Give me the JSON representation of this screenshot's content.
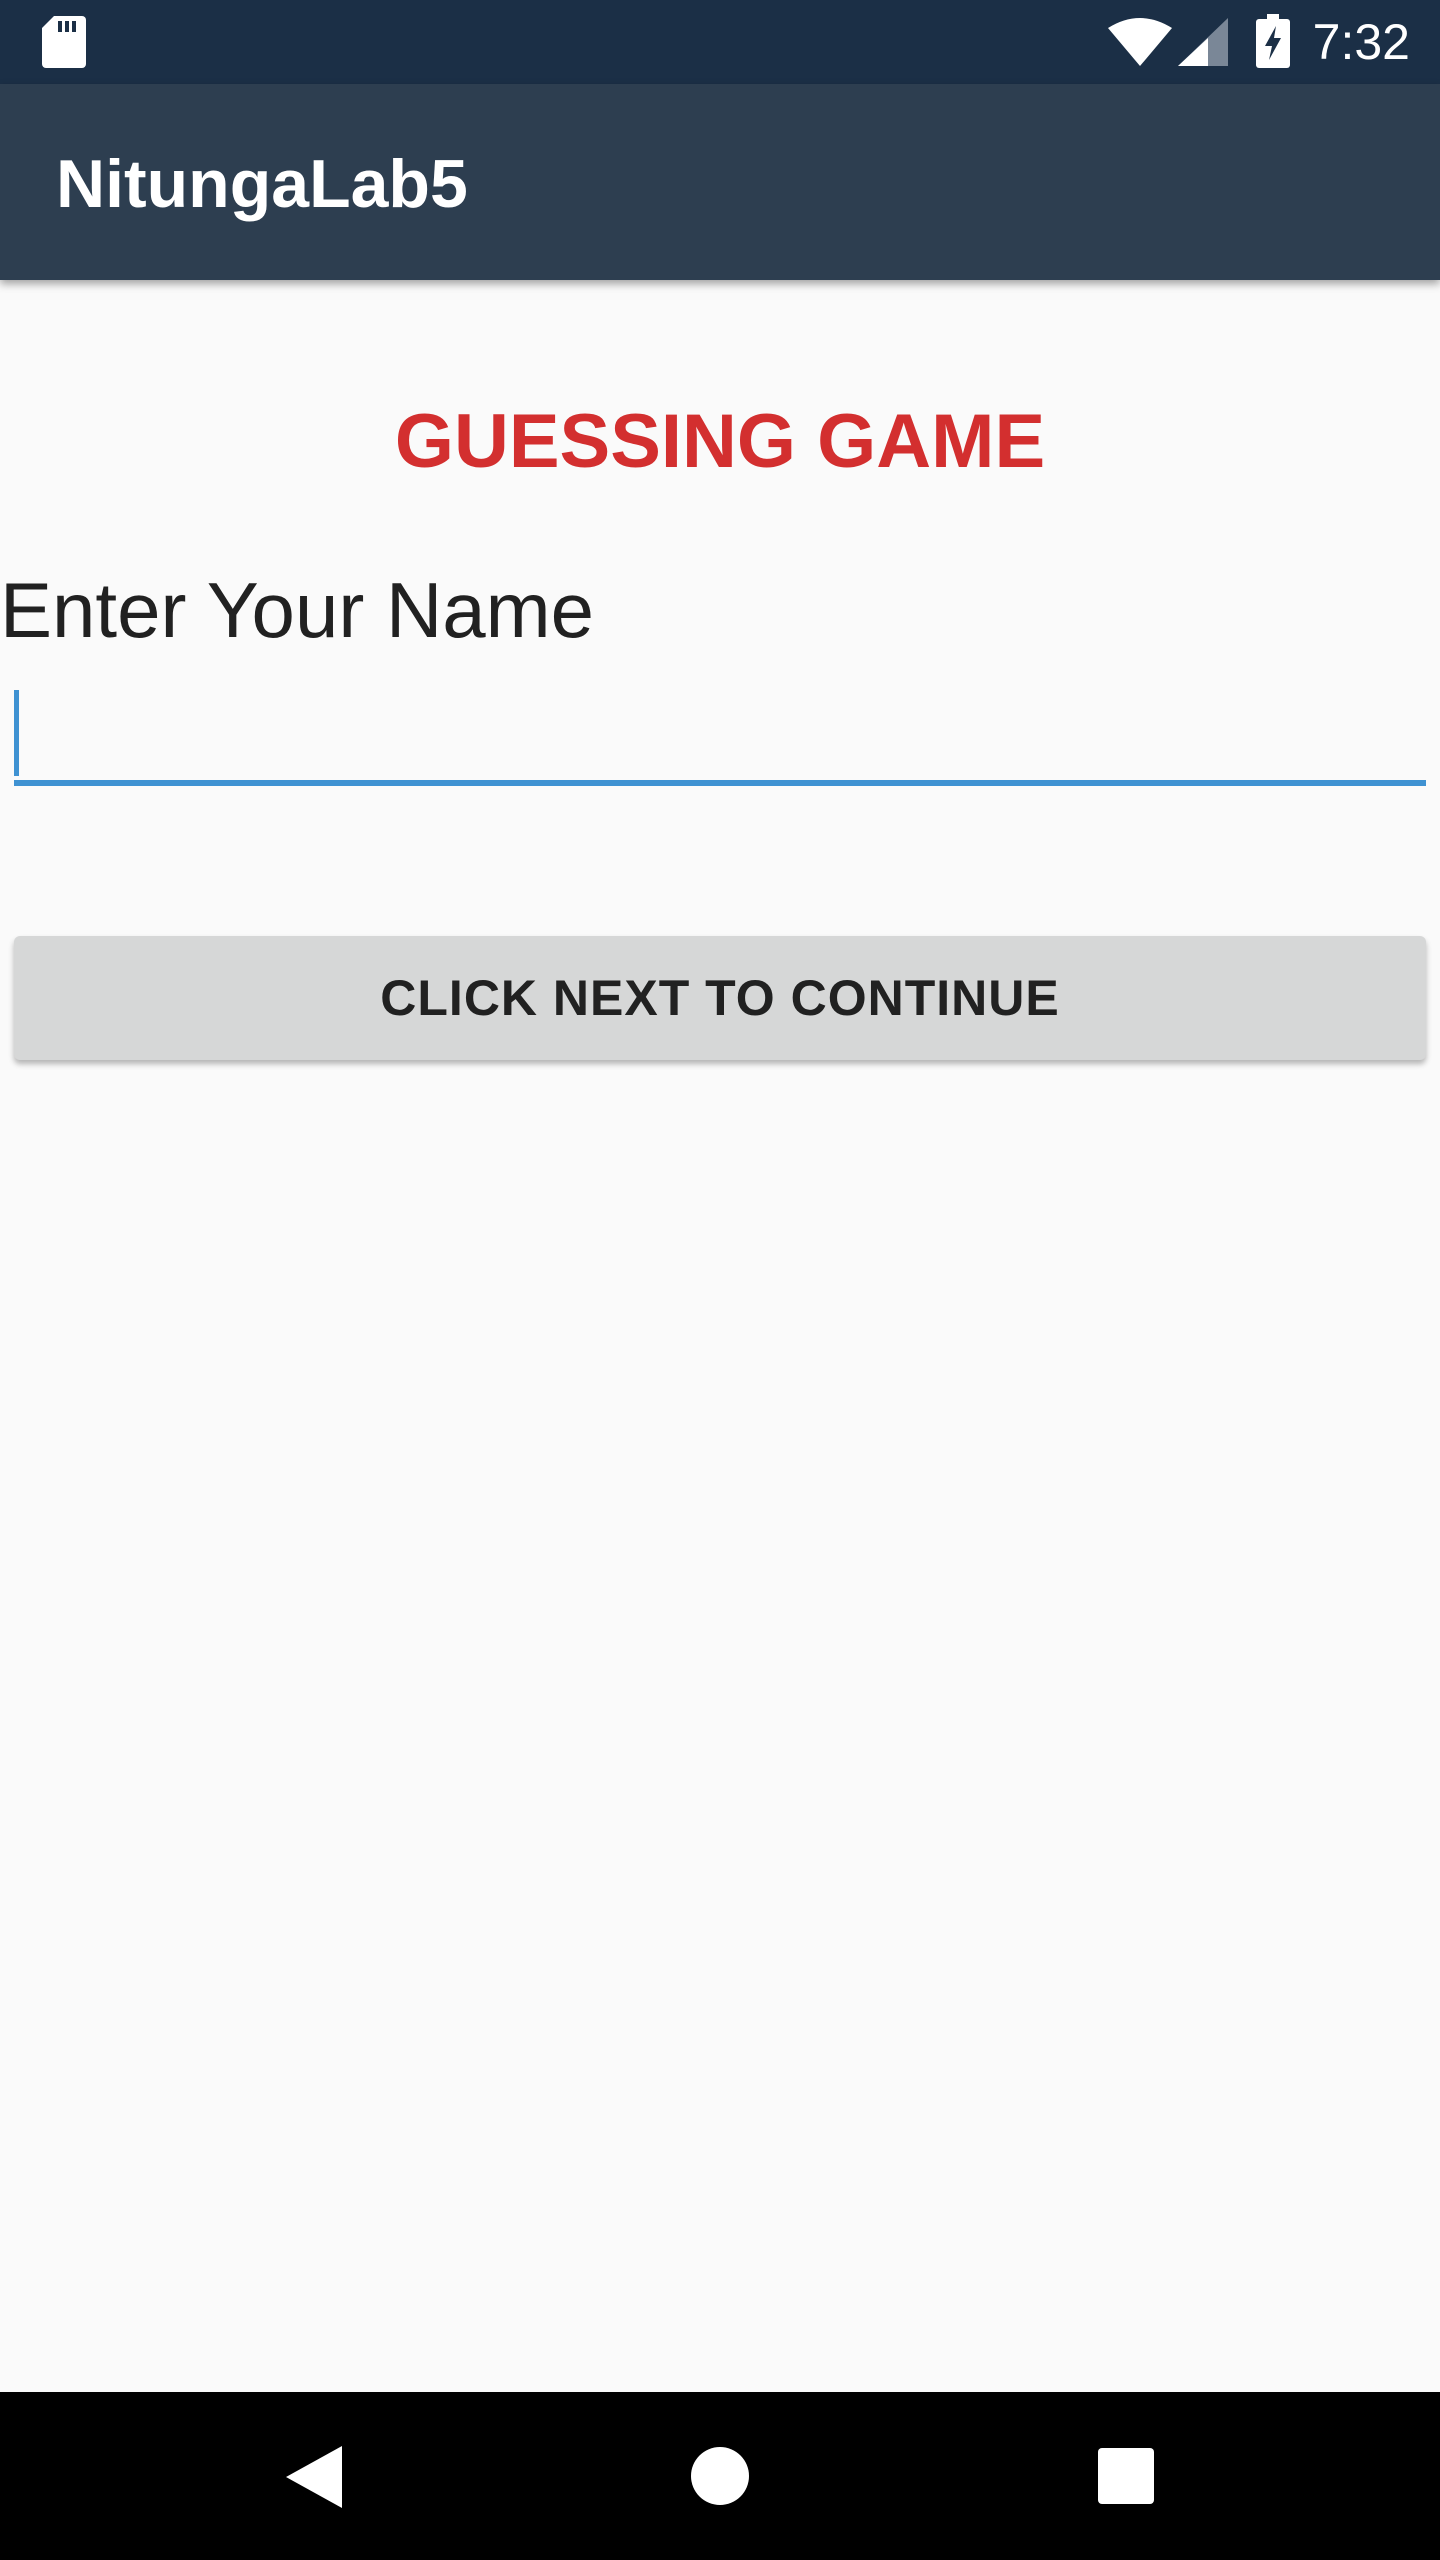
{
  "status_bar": {
    "time": "7:32",
    "icons": [
      "sd-card-icon",
      "wifi-icon",
      "cell-signal-icon",
      "battery-charging-icon"
    ]
  },
  "app_bar": {
    "title": "NitungaLab5"
  },
  "main": {
    "game_title": "GUESSING GAME",
    "name_label": "Enter Your Name",
    "name_input": {
      "value": "",
      "placeholder": ""
    },
    "next_button_label": "CLICK NEXT TO CONTINUE"
  },
  "nav_bar": {
    "icons": [
      "back-icon",
      "home-icon",
      "recents-icon"
    ]
  },
  "colors": {
    "status_bar": "#1b2f46",
    "app_bar": "#2d3e50",
    "accent": "#3f92d2",
    "title_red": "#d32f2f",
    "button_bg": "#d6d7d7",
    "background": "#fafafa"
  }
}
